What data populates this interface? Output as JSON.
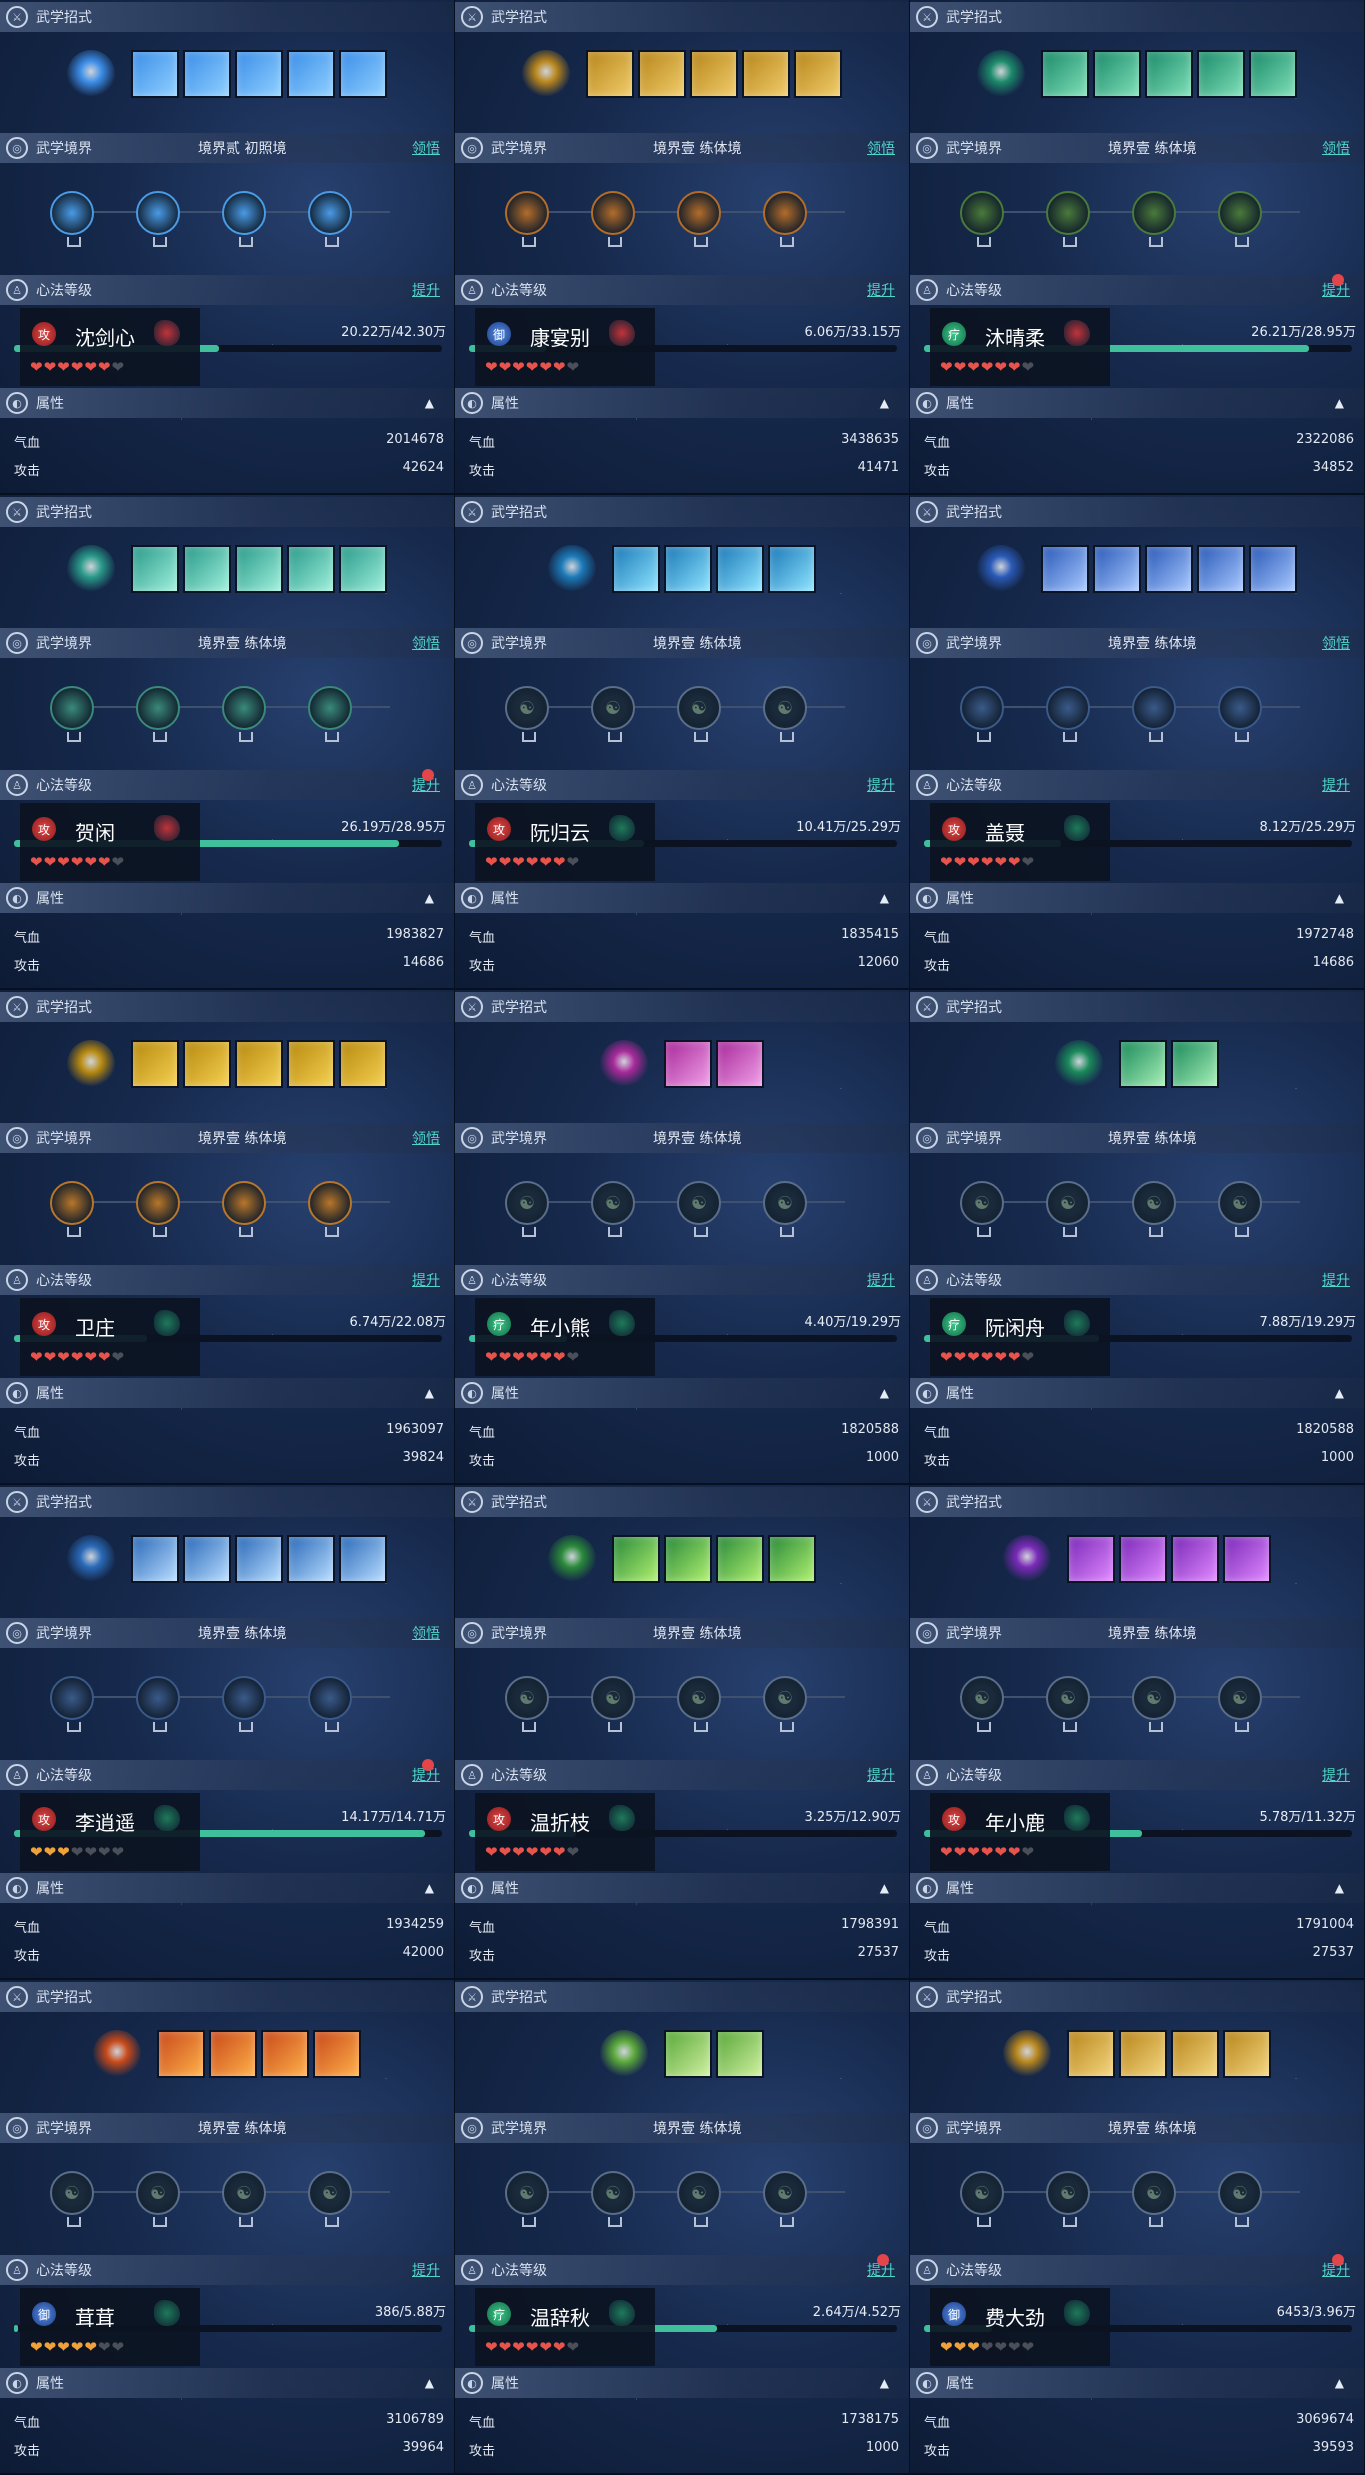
{
  "labels": {
    "skills": "武学招式",
    "realm": "武学境界",
    "mind": "心法等级",
    "attr": "属性",
    "hp": "气血",
    "atk": "攻击"
  },
  "cards": [
    {
      "name": "沈剑心",
      "role": "攻",
      "realm": "境界贰  初照境",
      "action": "领悟",
      "upgrade": "提升",
      "progress": "20.22万/42.30万",
      "fill": 0.48,
      "hearts": [
        "r",
        "r",
        "r",
        "r",
        "r",
        "r",
        "e"
      ],
      "stats": {
        "hp": "2014678",
        "atk": "42624"
      },
      "dot": false,
      "colors": [
        "#3c8ee8",
        "#8fd0ff"
      ],
      "ring": [
        "#4a9be6",
        4
      ],
      "emblem": "#c1333a",
      "skills": 5
    },
    {
      "name": "康宴别",
      "role": "御",
      "realm": "境界壹  练体境",
      "action": "领悟",
      "upgrade": "提升",
      "progress": "6.06万/33.15万",
      "fill": 0.18,
      "hearts": [
        "r",
        "r",
        "r",
        "r",
        "r",
        "r",
        "e"
      ],
      "stats": {
        "hp": "3438635",
        "atk": "41471"
      },
      "dot": false,
      "colors": [
        "#b8861c",
        "#f0cc6a"
      ],
      "ring": [
        "#b36d2a",
        4
      ],
      "emblem": "#c1333a",
      "skills": 5
    },
    {
      "name": "沐晴柔",
      "role": "疗",
      "realm": "境界壹  练体境",
      "action": "领悟",
      "upgrade": "提升",
      "progress": "26.21万/28.95万",
      "fill": 0.9,
      "hearts": [
        "r",
        "r",
        "r",
        "r",
        "r",
        "r",
        "e"
      ],
      "stats": {
        "hp": "2322086",
        "atk": "34852"
      },
      "dot": true,
      "colors": [
        "#1c8a6a",
        "#7ee0b8"
      ],
      "ring": [
        "#4a7a3a",
        4
      ],
      "emblem": "#c1333a",
      "skills": 5
    },
    {
      "name": "贺闲",
      "role": "攻",
      "realm": "境界壹  练体境",
      "action": "领悟",
      "upgrade": "提升",
      "progress": "26.19万/28.95万",
      "fill": 0.9,
      "hearts": [
        "r",
        "r",
        "r",
        "r",
        "r",
        "r",
        "e"
      ],
      "stats": {
        "hp": "1983827",
        "atk": "14686"
      },
      "dot": true,
      "colors": [
        "#2a9a8a",
        "#9ff0dc"
      ],
      "ring": [
        "#3a8a7a",
        4
      ],
      "emblem": "#c1333a",
      "skills": 5
    },
    {
      "name": "阮归云",
      "role": "攻",
      "realm": "境界壹  练体境",
      "action": "",
      "upgrade": "提升",
      "progress": "10.41万/25.29万",
      "fill": 0.41,
      "hearts": [
        "r",
        "r",
        "r",
        "r",
        "r",
        "r",
        "e"
      ],
      "stats": {
        "hp": "1835415",
        "atk": "12060"
      },
      "dot": false,
      "colors": [
        "#1c7ab8",
        "#8ee4ff"
      ],
      "ring": [
        "",
        0
      ],
      "emblem": "#1e7a5a",
      "skills": 4
    },
    {
      "name": "盖聂",
      "role": "攻",
      "realm": "境界壹  练体境",
      "action": "领悟",
      "upgrade": "提升",
      "progress": "8.12万/25.29万",
      "fill": 0.32,
      "hearts": [
        "r",
        "r",
        "r",
        "r",
        "r",
        "r",
        "e"
      ],
      "stats": {
        "hp": "1972748",
        "atk": "14686"
      },
      "dot": false,
      "colors": [
        "#2a5ab8",
        "#a8c8ff"
      ],
      "ring": [
        "#3a5a8a",
        4
      ],
      "emblem": "#1e7a5a",
      "skills": 5
    },
    {
      "name": "卫庄",
      "role": "攻",
      "realm": "境界壹  练体境",
      "action": "领悟",
      "upgrade": "提升",
      "progress": "6.74万/22.08万",
      "fill": 0.31,
      "hearts": [
        "r",
        "r",
        "r",
        "r",
        "r",
        "r",
        "e"
      ],
      "stats": {
        "hp": "1963097",
        "atk": "39824"
      },
      "dot": false,
      "colors": [
        "#b88a10",
        "#f4d050"
      ],
      "ring": [
        "#b8762a",
        4
      ],
      "emblem": "#1e7a5a",
      "skills": 5
    },
    {
      "name": "年小熊",
      "role": "疗",
      "realm": "境界壹  练体境",
      "action": "",
      "upgrade": "提升",
      "progress": "4.40万/19.29万",
      "fill": 0.23,
      "hearts": [
        "r",
        "r",
        "r",
        "r",
        "r",
        "r",
        "e"
      ],
      "stats": {
        "hp": "1820588",
        "atk": "1000"
      },
      "dot": false,
      "colors": [
        "#a82a9a",
        "#f0a0e8"
      ],
      "ring": [
        "",
        0
      ],
      "emblem": "#1e7a5a",
      "skills": 2
    },
    {
      "name": "阮闲舟",
      "role": "疗",
      "realm": "境界壹  练体境",
      "action": "",
      "upgrade": "提升",
      "progress": "7.88万/19.29万",
      "fill": 0.41,
      "hearts": [
        "r",
        "r",
        "r",
        "r",
        "r",
        "r",
        "e"
      ],
      "stats": {
        "hp": "1820588",
        "atk": "1000"
      },
      "dot": false,
      "colors": [
        "#1a8a5a",
        "#a8f0b8"
      ],
      "ring": [
        "",
        0
      ],
      "emblem": "#1e7a5a",
      "skills": 2
    },
    {
      "name": "李逍遥",
      "role": "攻",
      "realm": "境界壹  练体境",
      "action": "领悟",
      "upgrade": "提升",
      "progress": "14.17万/14.71万",
      "fill": 0.96,
      "hearts": [
        "o",
        "o",
        "o",
        "e",
        "e",
        "e",
        "e"
      ],
      "stats": {
        "hp": "1934259",
        "atk": "42000"
      },
      "dot": true,
      "colors": [
        "#2a6ab8",
        "#b8dcff"
      ],
      "ring": [
        "#3a5a8a",
        4
      ],
      "emblem": "#1e7a5a",
      "skills": 5
    },
    {
      "name": "温折枝",
      "role": "攻",
      "realm": "境界壹  练体境",
      "action": "",
      "upgrade": "提升",
      "progress": "3.25万/12.90万",
      "fill": 0.25,
      "hearts": [
        "r",
        "r",
        "r",
        "r",
        "r",
        "r",
        "e"
      ],
      "stats": {
        "hp": "1798391",
        "atk": "27537"
      },
      "dot": false,
      "colors": [
        "#2a8a3a",
        "#b0f070"
      ],
      "ring": [
        "",
        0
      ],
      "emblem": "#1e7a5a",
      "skills": 4
    },
    {
      "name": "年小鹿",
      "role": "攻",
      "realm": "境界壹  练体境",
      "action": "",
      "upgrade": "提升",
      "progress": "5.78万/11.32万",
      "fill": 0.51,
      "hearts": [
        "r",
        "r",
        "r",
        "r",
        "r",
        "r",
        "e"
      ],
      "stats": {
        "hp": "1791004",
        "atk": "27537"
      },
      "dot": false,
      "colors": [
        "#7a2ab8",
        "#e088ff"
      ],
      "ring": [
        "",
        0
      ],
      "emblem": "#1e7a5a",
      "skills": 4
    },
    {
      "name": "茸茸",
      "role": "御",
      "realm": "境界壹  练体境",
      "action": "",
      "upgrade": "提升",
      "progress": "386/5.88万",
      "fill": 0.01,
      "hearts": [
        "o",
        "o",
        "o",
        "o",
        "o",
        "e",
        "e"
      ],
      "stats": {
        "hp": "3106789",
        "atk": "39964"
      },
      "dot": false,
      "colors": [
        "#c84a1a",
        "#ffb04a"
      ],
      "ring": [
        "",
        0
      ],
      "emblem": "#1e7a5a",
      "skills": 4
    },
    {
      "name": "温辞秋",
      "role": "疗",
      "realm": "境界壹  练体境",
      "action": "",
      "upgrade": "提升",
      "progress": "2.64万/4.52万",
      "fill": 0.58,
      "hearts": [
        "r",
        "r",
        "r",
        "r",
        "r",
        "r",
        "e"
      ],
      "stats": {
        "hp": "1738175",
        "atk": "1000"
      },
      "dot": true,
      "colors": [
        "#5aa83a",
        "#d0f0a0"
      ],
      "ring": [
        "",
        0
      ],
      "emblem": "#1e7a5a",
      "skills": 2
    },
    {
      "name": "费大劲",
      "role": "御",
      "realm": "境界壹  练体境",
      "action": "",
      "upgrade": "提升",
      "progress": "6453/3.96万",
      "fill": 0.16,
      "hearts": [
        "o",
        "o",
        "o",
        "e",
        "e",
        "e",
        "e"
      ],
      "stats": {
        "hp": "3069674",
        "atk": "39593"
      },
      "dot": true,
      "colors": [
        "#b8861c",
        "#f4d680"
      ],
      "ring": [
        "",
        0
      ],
      "emblem": "#1e7a5a",
      "skills": 4
    }
  ]
}
